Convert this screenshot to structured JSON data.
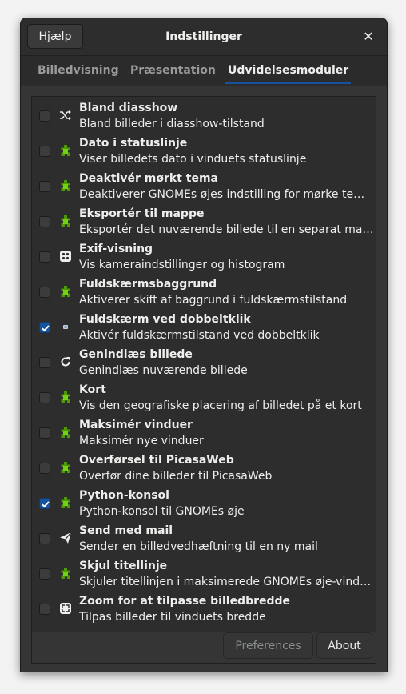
{
  "header": {
    "help_label": "Hjælp",
    "title": "Indstillinger",
    "close_glyph": "✕"
  },
  "tabs": [
    {
      "label": "Billedvisning"
    },
    {
      "label": "Præsentation"
    },
    {
      "label": "Udvidelsesmoduler"
    }
  ],
  "active_tab": "Udvidelsesmoduler",
  "plugins": [
    {
      "title": "Bland diasshow",
      "desc": "Bland billeder i diasshow-tilstand",
      "icon": "shuffle-icon",
      "checked": false
    },
    {
      "title": "Dato i statuslinje",
      "desc": "Viser billedets dato i vinduets statuslinje",
      "icon": "plugin-icon",
      "checked": false
    },
    {
      "title": "Deaktivér mørkt tema",
      "desc": "Deaktiverer GNOMEs øjes indstilling for mørke tema-v...",
      "icon": "plugin-icon",
      "checked": false
    },
    {
      "title": "Eksportér til mappe",
      "desc": "Eksportér det nuværende billede til en separat mappe",
      "icon": "plugin-icon",
      "checked": false
    },
    {
      "title": "Exif-visning",
      "desc": "Vis kameraindstillinger og histogram",
      "icon": "camera-settings-icon",
      "checked": false
    },
    {
      "title": "Fuldskærmsbaggrund",
      "desc": "Aktiverer skift af baggrund i fuldskærmstilstand",
      "icon": "plugin-icon",
      "checked": false
    },
    {
      "title": "Fuldskærm ved dobbeltklik",
      "desc": "Aktivér fuldskærmstilstand ved dobbeltklik",
      "icon": "mouse-pointer-icon",
      "checked": true
    },
    {
      "title": "Genindlæs billede",
      "desc": "Genindlæs nuværende billede",
      "icon": "reload-icon",
      "checked": false
    },
    {
      "title": "Kort",
      "desc": "Vis den geografiske placering af billedet på et kort",
      "icon": "plugin-icon",
      "checked": false
    },
    {
      "title": "Maksimér vinduer",
      "desc": "Maksimér nye vinduer",
      "icon": "plugin-icon",
      "checked": false
    },
    {
      "title": "Overførsel til PicasaWeb",
      "desc": "Overfør dine billeder til PicasaWeb",
      "icon": "plugin-icon",
      "checked": false
    },
    {
      "title": "Python-konsol",
      "desc": "Python-konsol til GNOMEs øje",
      "icon": "plugin-icon",
      "checked": true
    },
    {
      "title": "Send med mail",
      "desc": "Sender en billedvedhæftning til en ny mail",
      "icon": "send-icon",
      "checked": false
    },
    {
      "title": "Skjul titellinje",
      "desc": "Skjuler titellinjen i maksimerede GNOMEs øje-vinduer",
      "icon": "plugin-icon",
      "checked": false
    },
    {
      "title": "Zoom for at tilpasse billedbredde",
      "desc": "Tilpas billeder til vinduets bredde",
      "icon": "zoom-fit-icon",
      "checked": false
    }
  ],
  "footer": {
    "preferences_label": "Preferences",
    "about_label": "About"
  },
  "colors": {
    "accent": "#15539e",
    "plugin_green": "#4e9a06"
  }
}
